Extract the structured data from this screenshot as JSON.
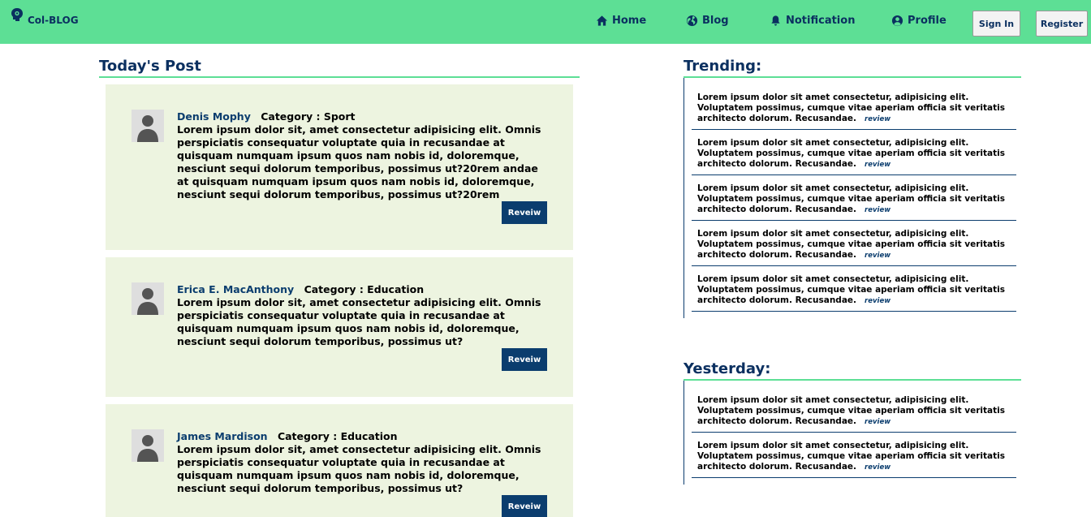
{
  "brand": {
    "name": "Col-BLOG",
    "icon": "head-gear-icon"
  },
  "nav": {
    "items": [
      {
        "label": "Home",
        "icon": "home-icon"
      },
      {
        "label": "Blog",
        "icon": "globe-icon"
      },
      {
        "label": "Notification",
        "icon": "bell-icon"
      },
      {
        "label": "Profile",
        "icon": "user-circle-icon"
      }
    ],
    "sign_in": "Sign In",
    "register": "Register"
  },
  "colors": {
    "navbar": "#5ddf95",
    "primary": "#0b3d6e",
    "card": "#edf4e0"
  },
  "todays_post": {
    "title": "Today's Post",
    "posts": [
      {
        "author": "Denis Mophy",
        "category": "Category : Sport",
        "text": "Lorem ipsum dolor sit, amet consectetur adipisicing elit. Omnis perspiciatis consequatur voluptate quia in recusandae at quisquam numquam ipsum quos nam nobis id, doloremque, nesciunt sequi dolorum temporibus, possimus ut?20rem andae at quisquam numquam ipsum quos nam nobis id, doloremque, nesciunt sequi dolorum temporibus, possimus ut?20rem",
        "button": "Reveiw"
      },
      {
        "author": "Erica E. MacAnthony",
        "category": "Category : Education",
        "text": "Lorem ipsum dolor sit, amet consectetur adipisicing elit. Omnis perspiciatis consequatur voluptate quia in recusandae at quisquam numquam ipsum quos nam nobis id, doloremque, nesciunt sequi dolorum temporibus, possimus ut?",
        "button": "Reveiw"
      },
      {
        "author": "James Mardison",
        "category": "Category : Education",
        "text": "Lorem ipsum dolor sit, amet consectetur adipisicing elit. Omnis perspiciatis consequatur voluptate quia in recusandae at quisquam numquam ipsum quos nam nobis id, doloremque, nesciunt sequi dolorum temporibus, possimus ut?",
        "button": "Reveiw"
      }
    ]
  },
  "trending": {
    "title": "Trending:",
    "items": [
      {
        "text": "Lorem ipsum dolor sit amet consectetur, adipisicing elit. Voluptatem possimus, cumque vitae aperiam officia sit veritatis architecto dolorum. Recusandae.",
        "link": "review"
      },
      {
        "text": "Lorem ipsum dolor sit amet consectetur, adipisicing elit. Voluptatem possimus, cumque vitae aperiam officia sit veritatis architecto dolorum. Recusandae.",
        "link": "review"
      },
      {
        "text": "Lorem ipsum dolor sit amet consectetur, adipisicing elit. Voluptatem possimus, cumque vitae aperiam officia sit veritatis architecto dolorum. Recusandae.",
        "link": "review"
      },
      {
        "text": "Lorem ipsum dolor sit amet consectetur, adipisicing elit. Voluptatem possimus, cumque vitae aperiam officia sit veritatis architecto dolorum. Recusandae.",
        "link": "review"
      },
      {
        "text": "Lorem ipsum dolor sit amet consectetur, adipisicing elit. Voluptatem possimus, cumque vitae aperiam officia sit veritatis architecto dolorum. Recusandae.",
        "link": "review"
      }
    ]
  },
  "yesterday": {
    "title": "Yesterday:",
    "items": [
      {
        "text": "Lorem ipsum dolor sit amet consectetur, adipisicing elit. Voluptatem possimus, cumque vitae aperiam officia sit veritatis architecto dolorum. Recusandae.",
        "link": "review"
      },
      {
        "text": "Lorem ipsum dolor sit amet consectetur, adipisicing elit. Voluptatem possimus, cumque vitae aperiam officia sit veritatis architecto dolorum. Recusandae.",
        "link": "review"
      }
    ]
  }
}
